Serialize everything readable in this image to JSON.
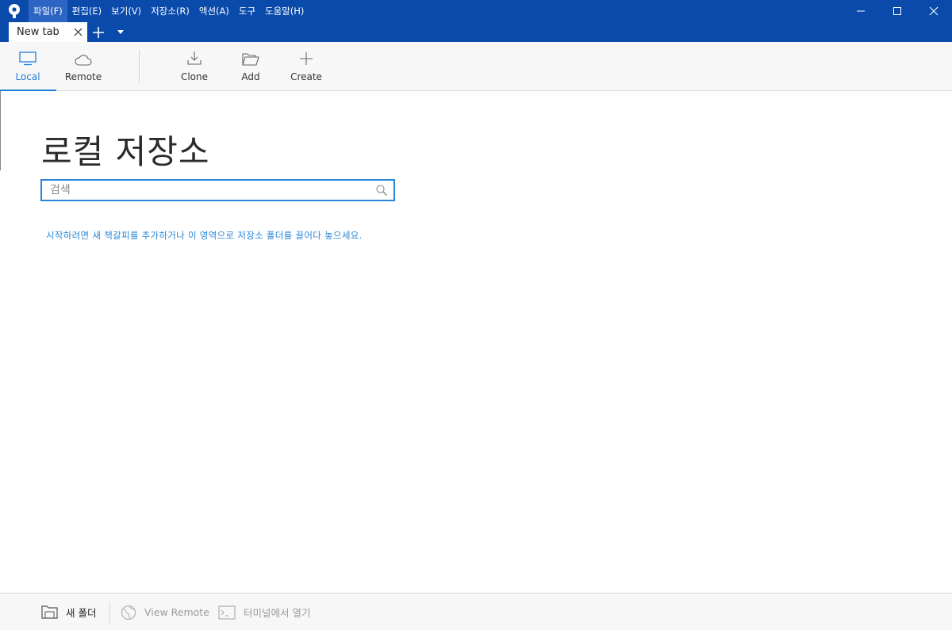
{
  "menu": {
    "items": [
      {
        "label": "파일(F)"
      },
      {
        "label": "편집(E)"
      },
      {
        "label": "보기(V)"
      },
      {
        "label": "저장소(R)"
      },
      {
        "label": "액션(A)"
      },
      {
        "label": "도구"
      },
      {
        "label": "도움말(H)"
      }
    ]
  },
  "tabs": {
    "active_label": "New tab"
  },
  "toolbar": {
    "local_label": "Local",
    "remote_label": "Remote",
    "clone_label": "Clone",
    "add_label": "Add",
    "create_label": "Create"
  },
  "main": {
    "title": "로컬 저장소",
    "search_placeholder": "검색",
    "hint": "시작하려면 새 책갈피를 추가하거나 이 영역으로 저장소 폴더를 끌어다 놓으세요."
  },
  "bottombar": {
    "new_folder_label": "새 폴더",
    "view_remote_label": "View Remote",
    "open_terminal_label": "터미널에서 열기"
  },
  "colors": {
    "titlebar": "#0a4aab",
    "accent": "#1d7fd6"
  }
}
